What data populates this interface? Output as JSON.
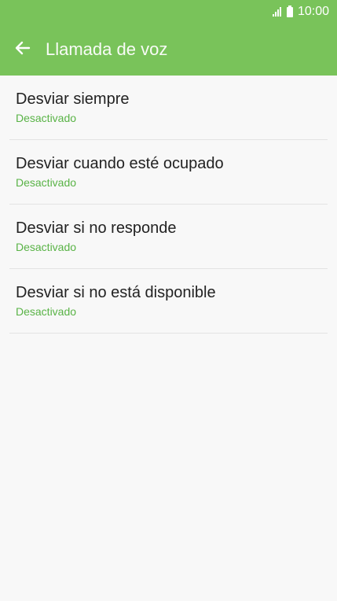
{
  "status": {
    "time": "10:00",
    "signal_icon": "signal-icon",
    "battery_icon": "battery-icon"
  },
  "header": {
    "title": "Llamada de voz",
    "back_icon": "arrow-left-icon"
  },
  "colors": {
    "accent": "#79c35a",
    "status_text": "#59b346",
    "background": "#f8f8f8"
  },
  "items": [
    {
      "label": "Desviar siempre",
      "status": "Desactivado"
    },
    {
      "label": "Desviar cuando esté ocupado",
      "status": "Desactivado"
    },
    {
      "label": "Desviar si no responde",
      "status": "Desactivado"
    },
    {
      "label": "Desviar si no está disponible",
      "status": "Desactivado"
    }
  ]
}
